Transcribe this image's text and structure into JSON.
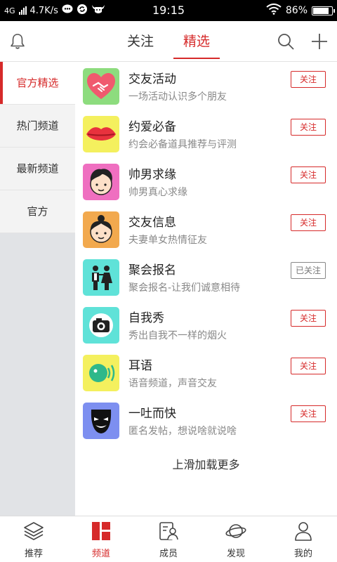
{
  "status_bar": {
    "network": "4G",
    "speed": "4.7K/s",
    "time": "19:15",
    "battery": "86%",
    "battery_level": 0.86,
    "icons": [
      "signal-icon",
      "chat-icon",
      "sync-icon",
      "bull-app-icon",
      "wifi-icon",
      "battery-icon"
    ]
  },
  "header": {
    "tabs": [
      {
        "label": "关注",
        "active": false
      },
      {
        "label": "精选",
        "active": true
      }
    ],
    "icons": [
      "bell-icon",
      "search-icon",
      "add-icon"
    ]
  },
  "sidebar": {
    "items": [
      {
        "label": "官方精选",
        "active": true
      },
      {
        "label": "热门频道",
        "active": false
      },
      {
        "label": "最新频道",
        "active": false
      },
      {
        "label": "官方",
        "active": false
      }
    ]
  },
  "channels": [
    {
      "name": "交友活动",
      "desc": "一场活动认识多个朋友",
      "button": "关注",
      "followed": false,
      "icon": "heart-handshake-icon",
      "color": "#8ddc7e"
    },
    {
      "name": "约爱必备",
      "desc": "约会必备道具推荐与评测",
      "button": "关注",
      "followed": false,
      "icon": "lips-icon",
      "color": "#f4f05e"
    },
    {
      "name": "帅男求缘",
      "desc": "帅男真心求缘",
      "button": "关注",
      "followed": false,
      "icon": "boy-face-icon",
      "color": "#ef6fc0"
    },
    {
      "name": "交友信息",
      "desc": "夫妻单女热情征友",
      "button": "关注",
      "followed": false,
      "icon": "girl-face-icon",
      "color": "#f2a94e"
    },
    {
      "name": "聚会报名",
      "desc": "聚会报名-让我们诚意相待",
      "button": "已关注",
      "followed": true,
      "icon": "couple-icon",
      "color": "#5fe2d8"
    },
    {
      "name": "自我秀",
      "desc": "秀出自我不一样的烟火",
      "button": "关注",
      "followed": false,
      "icon": "camera-icon",
      "color": "#5fe2d8"
    },
    {
      "name": "耳语",
      "desc": "语音频道，声音交友",
      "button": "关注",
      "followed": false,
      "icon": "voice-icon",
      "color": "#f4f05e"
    },
    {
      "name": "一吐而快",
      "desc": "匿名发帖，想说啥就说啥",
      "button": "关注",
      "followed": false,
      "icon": "mask-icon",
      "color": "#7d8ff0"
    }
  ],
  "load_more": "上滑加载更多",
  "bottom_nav": [
    {
      "label": "推荐",
      "icon": "layers-icon",
      "active": false
    },
    {
      "label": "频道",
      "icon": "channel-grid-icon",
      "active": true
    },
    {
      "label": "成员",
      "icon": "members-icon",
      "active": false
    },
    {
      "label": "发现",
      "icon": "planet-icon",
      "active": false
    },
    {
      "label": "我的",
      "icon": "profile-icon",
      "active": false
    }
  ],
  "colors": {
    "accent": "#d62a2a",
    "sidebar_bg": "#e1e3e6",
    "status_bar": "#000000"
  }
}
